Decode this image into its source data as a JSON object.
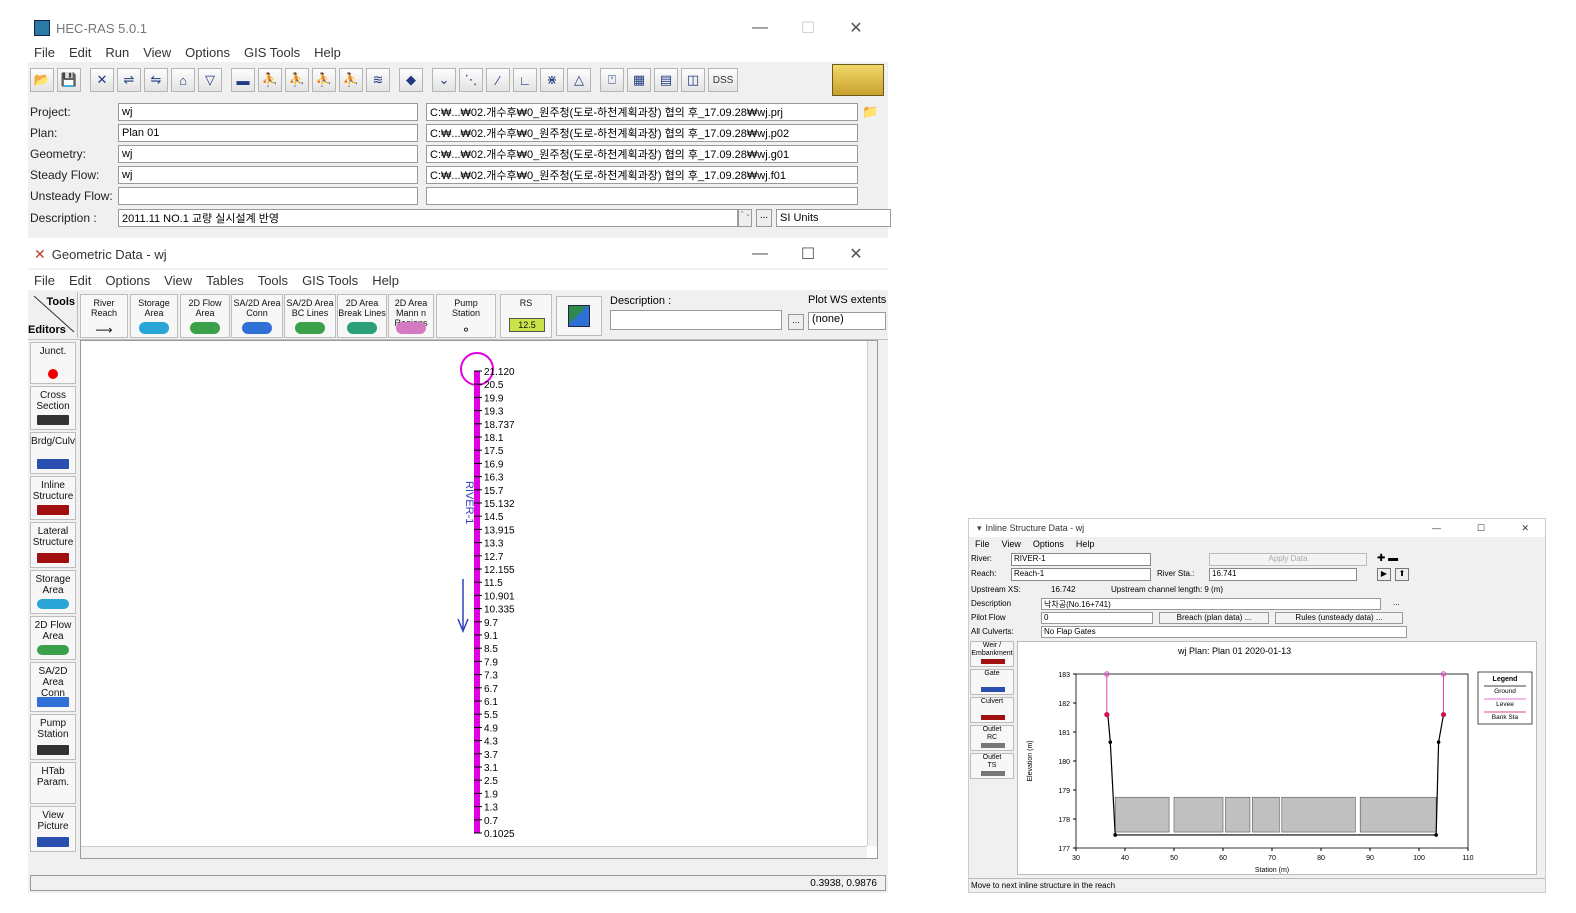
{
  "main": {
    "title": "HEC-RAS 5.0.1",
    "menu": [
      "File",
      "Edit",
      "Run",
      "View",
      "Options",
      "GIS Tools",
      "Help"
    ],
    "dss_label": "DSS",
    "fields": [
      {
        "label": "Project:",
        "value": "wj",
        "path": "C:₩...₩02.개수후₩0_원주청(도로-하천계획과장) 협의 후_17.09.28₩wj.prj"
      },
      {
        "label": "Plan:",
        "value": "Plan 01",
        "path": "C:₩...₩02.개수후₩0_원주청(도로-하천계획과장) 협의 후_17.09.28₩wj.p02"
      },
      {
        "label": "Geometry:",
        "value": "wj",
        "path": "C:₩...₩02.개수후₩0_원주청(도로-하천계획과장) 협의 후_17.09.28₩wj.g01"
      },
      {
        "label": "Steady Flow:",
        "value": "wj",
        "path": "C:₩...₩02.개수후₩0_원주청(도로-하천계획과장) 협의 후_17.09.28₩wj.f01"
      },
      {
        "label": "Unsteady Flow:",
        "value": "",
        "path": ""
      }
    ],
    "description_label": "Description :",
    "description_value": "2011.11 NO.1 교량 실시설계 반영",
    "units": "SI Units"
  },
  "geometric": {
    "title": "Geometric Data - wj",
    "menu": [
      "File",
      "Edit",
      "Options",
      "View",
      "Tables",
      "Tools",
      "GIS Tools",
      "Help"
    ],
    "tools_label": "Tools",
    "editors_label": "Editors",
    "top_tools": [
      {
        "name": "river-reach",
        "label": "River\nReach"
      },
      {
        "name": "storage-area",
        "label": "Storage\nArea"
      },
      {
        "name": "2d-flow-area",
        "label": "2D Flow\nArea"
      },
      {
        "name": "sa-2d-conn",
        "label": "SA/2D Area\nConn"
      },
      {
        "name": "sa-2d-bc-lines",
        "label": "SA/2D Area\nBC Lines"
      },
      {
        "name": "2d-break-lines",
        "label": "2D Area\nBreak Lines"
      },
      {
        "name": "2d-mann-regions",
        "label": "2D Area\nMann n\nRegions"
      },
      {
        "name": "pump-station",
        "label": "Pump\nStation"
      },
      {
        "name": "rs",
        "label": "RS"
      }
    ],
    "rs_badge": "12.5",
    "description_label": "Description :",
    "plot_ws_label": "Plot WS extents",
    "plot_ws_value": "(none)",
    "left_tools": [
      {
        "name": "junct",
        "label": "Junct."
      },
      {
        "name": "cross-section",
        "label": "Cross\nSection"
      },
      {
        "name": "brdg-culv",
        "label": "Brdg/Culv"
      },
      {
        "name": "inline-structure",
        "label": "Inline\nStructure"
      },
      {
        "name": "lateral-structure",
        "label": "Lateral\nStructure"
      },
      {
        "name": "storage-area",
        "label": "Storage\nArea"
      },
      {
        "name": "2d-flow-area",
        "label": "2D Flow\nArea"
      },
      {
        "name": "sa-2d-conn",
        "label": "SA/2D Area\nConn"
      },
      {
        "name": "pump-station",
        "label": "Pump\nStation"
      },
      {
        "name": "htab-param",
        "label": "HTab\nParam."
      },
      {
        "name": "view-picture",
        "label": "View\nPicture"
      }
    ],
    "river_label": "RIVER-1",
    "reach_label": "Reach-1",
    "stations": [
      "21.120",
      "20.5",
      "19.9",
      "19.3",
      "18.737",
      "18.1",
      "17.5",
      "16.9",
      "16.3",
      "15.7",
      "15.132",
      "14.5",
      "13.915",
      "13.3",
      "12.7",
      "12.155",
      "11.5",
      "10.901",
      "10.335",
      "9.7",
      "9.1",
      "8.5",
      "7.9",
      "7.3",
      "6.7",
      "6.1",
      "5.5",
      "4.9",
      "4.3",
      "3.7",
      "3.1",
      "2.5",
      "1.9",
      "1.3",
      "0.7",
      "0.1025"
    ],
    "status_coords": "0.3938, 0.9876"
  },
  "inline": {
    "title": "Inline Structure Data - wj",
    "menu": [
      "File",
      "View",
      "Options",
      "Help"
    ],
    "river_label": "River:",
    "river_value": "RIVER-1",
    "reach_label": "Reach:",
    "reach_value": "Reach-1",
    "river_sta_label": "River Sta.:",
    "river_sta_value": "16.741",
    "apply_label": "Apply Data",
    "upstream_xs_label": "Upstream XS:",
    "upstream_xs_value": "16.742",
    "channel_length": "Upstream channel length: 9 (m)",
    "description_label": "Description",
    "description_value": "낙차공(No.16+741)",
    "pilot_flow_label": "Pilot Flow",
    "pilot_flow_value": "0",
    "breach_label": "Breach (plan data) ...",
    "rules_label": "Rules (unsteady data) ...",
    "all_culverts_label": "All Culverts:",
    "all_culverts_value": "No Flap Gates",
    "side_tools": [
      "Weir /\nEmbankment",
      "Gate",
      "Culvert",
      "Outlet\nRC",
      "Outlet\nTS"
    ],
    "status": "Move to next inline structure in the reach"
  },
  "chart_data": {
    "type": "line",
    "title": "wj        Plan: Plan 01     2020-01-13",
    "xlabel": "Station (m)",
    "ylabel": "Elevation (m)",
    "xlim": [
      30,
      110
    ],
    "ylim": [
      177,
      183
    ],
    "xticks": [
      "30",
      "40",
      "50",
      "60",
      "70",
      "80",
      "90",
      "100",
      "110"
    ],
    "yticks": [
      "177",
      "178",
      "179",
      "180",
      "181",
      "182",
      "183"
    ],
    "legend": {
      "title": "Legend",
      "entries": [
        "Ground",
        "Levee",
        "Bank Sta"
      ],
      "placement": "right"
    },
    "ground": [
      [
        37,
        180.65
      ],
      [
        38,
        177.45
      ],
      [
        103.5,
        177.45
      ],
      [
        104,
        180.65
      ]
    ],
    "left_bank": [
      [
        36.5,
        181.6
      ],
      [
        37,
        180.65
      ]
    ],
    "right_bank": [
      [
        104,
        180.65
      ],
      [
        105,
        181.6
      ]
    ],
    "levees": [
      [
        36.3,
        183
      ],
      [
        36.3,
        181.6
      ],
      [
        105,
        183
      ],
      [
        105,
        181.6
      ]
    ],
    "weir_blocks": [
      [
        38,
        49
      ],
      [
        50,
        60
      ],
      [
        60.5,
        65.5
      ],
      [
        66,
        71.5
      ],
      [
        72,
        87
      ],
      [
        88,
        103.5
      ]
    ],
    "weir_top": 178.75,
    "weir_bottom": 177.65,
    "colors": {
      "ground": "#000000",
      "levee": "#e040c0",
      "bank_sta": "#d01050",
      "fill": "#c0c0c0"
    }
  }
}
